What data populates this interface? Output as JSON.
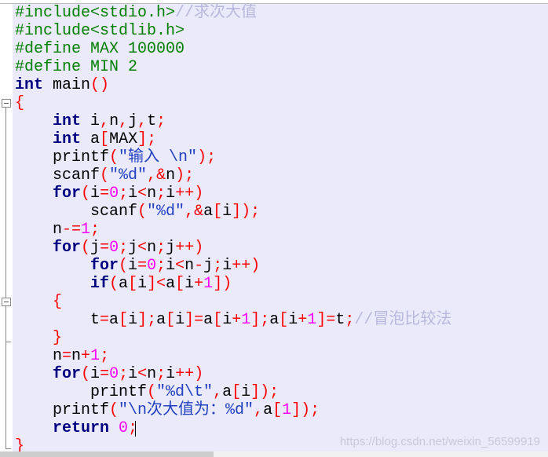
{
  "editor": {
    "lines": [
      [
        [
          "pp",
          "#include<stdio.h>"
        ],
        [
          "cm",
          "//求次大值"
        ]
      ],
      [
        [
          "pp",
          "#include<stdlib.h>"
        ]
      ],
      [
        [
          "pp",
          "#define MAX 100000"
        ]
      ],
      [
        [
          "pp",
          "#define MIN 2"
        ]
      ],
      [
        [
          "kw",
          "int"
        ],
        [
          "id",
          " main"
        ],
        [
          "op",
          "()"
        ]
      ],
      [
        [
          "op",
          "{"
        ]
      ],
      [
        [
          "id",
          "    "
        ],
        [
          "kw",
          "int"
        ],
        [
          "id",
          " i"
        ],
        [
          "op",
          ","
        ],
        [
          "id",
          "n"
        ],
        [
          "op",
          ","
        ],
        [
          "id",
          "j"
        ],
        [
          "op",
          ","
        ],
        [
          "id",
          "t"
        ],
        [
          "op",
          ";"
        ]
      ],
      [
        [
          "id",
          "    "
        ],
        [
          "kw",
          "int"
        ],
        [
          "id",
          " a"
        ],
        [
          "op",
          "["
        ],
        [
          "id",
          "MAX"
        ],
        [
          "op",
          "];"
        ]
      ],
      [
        [
          "id",
          "    printf"
        ],
        [
          "op",
          "("
        ],
        [
          "str",
          "\"输入 \\n\""
        ],
        [
          "op",
          ");"
        ]
      ],
      [
        [
          "id",
          "    scanf"
        ],
        [
          "op",
          "("
        ],
        [
          "str",
          "\"%d\""
        ],
        [
          "op",
          ",&"
        ],
        [
          "id",
          "n"
        ],
        [
          "op",
          ");"
        ]
      ],
      [
        [
          "id",
          "    "
        ],
        [
          "kw",
          "for"
        ],
        [
          "op",
          "("
        ],
        [
          "id",
          "i"
        ],
        [
          "op",
          "="
        ],
        [
          "num",
          "0"
        ],
        [
          "op",
          ";"
        ],
        [
          "id",
          "i"
        ],
        [
          "op",
          "<"
        ],
        [
          "id",
          "n"
        ],
        [
          "op",
          ";"
        ],
        [
          "id",
          "i"
        ],
        [
          "op",
          "++)"
        ]
      ],
      [
        [
          "id",
          "        scanf"
        ],
        [
          "op",
          "("
        ],
        [
          "str",
          "\"%d\""
        ],
        [
          "op",
          ",&"
        ],
        [
          "id",
          "a"
        ],
        [
          "op",
          "["
        ],
        [
          "id",
          "i"
        ],
        [
          "op",
          "]);"
        ]
      ],
      [
        [
          "id",
          "    n"
        ],
        [
          "op",
          "-="
        ],
        [
          "num",
          "1"
        ],
        [
          "op",
          ";"
        ]
      ],
      [
        [
          "id",
          "    "
        ],
        [
          "kw",
          "for"
        ],
        [
          "op",
          "("
        ],
        [
          "id",
          "j"
        ],
        [
          "op",
          "="
        ],
        [
          "num",
          "0"
        ],
        [
          "op",
          ";"
        ],
        [
          "id",
          "j"
        ],
        [
          "op",
          "<"
        ],
        [
          "id",
          "n"
        ],
        [
          "op",
          ";"
        ],
        [
          "id",
          "j"
        ],
        [
          "op",
          "++)"
        ]
      ],
      [
        [
          "id",
          "        "
        ],
        [
          "kw",
          "for"
        ],
        [
          "op",
          "("
        ],
        [
          "id",
          "i"
        ],
        [
          "op",
          "="
        ],
        [
          "num",
          "0"
        ],
        [
          "op",
          ";"
        ],
        [
          "id",
          "i"
        ],
        [
          "op",
          "<"
        ],
        [
          "id",
          "n"
        ],
        [
          "op",
          "-"
        ],
        [
          "id",
          "j"
        ],
        [
          "op",
          ";"
        ],
        [
          "id",
          "i"
        ],
        [
          "op",
          "++)"
        ]
      ],
      [
        [
          "id",
          "        "
        ],
        [
          "kw",
          "if"
        ],
        [
          "op",
          "("
        ],
        [
          "id",
          "a"
        ],
        [
          "op",
          "["
        ],
        [
          "id",
          "i"
        ],
        [
          "op",
          "]<"
        ],
        [
          "id",
          "a"
        ],
        [
          "op",
          "["
        ],
        [
          "id",
          "i"
        ],
        [
          "op",
          "+"
        ],
        [
          "num",
          "1"
        ],
        [
          "op",
          "])"
        ]
      ],
      [
        [
          "id",
          "    "
        ],
        [
          "op",
          "{"
        ]
      ],
      [
        [
          "id",
          "        t"
        ],
        [
          "op",
          "="
        ],
        [
          "id",
          "a"
        ],
        [
          "op",
          "["
        ],
        [
          "id",
          "i"
        ],
        [
          "op",
          "];"
        ],
        [
          "id",
          "a"
        ],
        [
          "op",
          "["
        ],
        [
          "id",
          "i"
        ],
        [
          "op",
          "]="
        ],
        [
          "id",
          "a"
        ],
        [
          "op",
          "["
        ],
        [
          "id",
          "i"
        ],
        [
          "op",
          "+"
        ],
        [
          "num",
          "1"
        ],
        [
          "op",
          "];"
        ],
        [
          "id",
          "a"
        ],
        [
          "op",
          "["
        ],
        [
          "id",
          "i"
        ],
        [
          "op",
          "+"
        ],
        [
          "num",
          "1"
        ],
        [
          "op",
          "]="
        ],
        [
          "id",
          "t"
        ],
        [
          "op",
          ";"
        ],
        [
          "cm",
          "//冒泡比较法"
        ]
      ],
      [
        [
          "id",
          "    "
        ],
        [
          "op",
          "}"
        ]
      ],
      [
        [
          "id",
          "    n"
        ],
        [
          "op",
          "="
        ],
        [
          "id",
          "n"
        ],
        [
          "op",
          "+"
        ],
        [
          "num",
          "1"
        ],
        [
          "op",
          ";"
        ]
      ],
      [
        [
          "id",
          "    "
        ],
        [
          "kw",
          "for"
        ],
        [
          "op",
          "("
        ],
        [
          "id",
          "i"
        ],
        [
          "op",
          "="
        ],
        [
          "num",
          "0"
        ],
        [
          "op",
          ";"
        ],
        [
          "id",
          "i"
        ],
        [
          "op",
          "<"
        ],
        [
          "id",
          "n"
        ],
        [
          "op",
          ";"
        ],
        [
          "id",
          "i"
        ],
        [
          "op",
          "++)"
        ]
      ],
      [
        [
          "id",
          "        printf"
        ],
        [
          "op",
          "("
        ],
        [
          "str",
          "\"%d\\t\""
        ],
        [
          "op",
          ","
        ],
        [
          "id",
          "a"
        ],
        [
          "op",
          "["
        ],
        [
          "id",
          "i"
        ],
        [
          "op",
          "]);"
        ]
      ],
      [
        [
          "id",
          "    printf"
        ],
        [
          "op",
          "("
        ],
        [
          "str",
          "\"\\n次大值为：%d\""
        ],
        [
          "op",
          ","
        ],
        [
          "id",
          "a"
        ],
        [
          "op",
          "["
        ],
        [
          "num",
          "1"
        ],
        [
          "op",
          "]);"
        ]
      ],
      [
        [
          "id",
          "    "
        ],
        [
          "kw",
          "return"
        ],
        [
          "id",
          " "
        ],
        [
          "num",
          "0"
        ],
        [
          "op",
          ";"
        ]
      ],
      [
        [
          "op",
          "}"
        ]
      ]
    ]
  },
  "colors": {
    "background": "#eaeafb",
    "preprocessor": "#008000",
    "keyword": "#000080",
    "operator": "#ff0000",
    "number": "#ff00ff",
    "string": "#2040c0",
    "comment": "#b8b8dc"
  },
  "watermark": "https://blog.csdn.net/weixin_56599919"
}
